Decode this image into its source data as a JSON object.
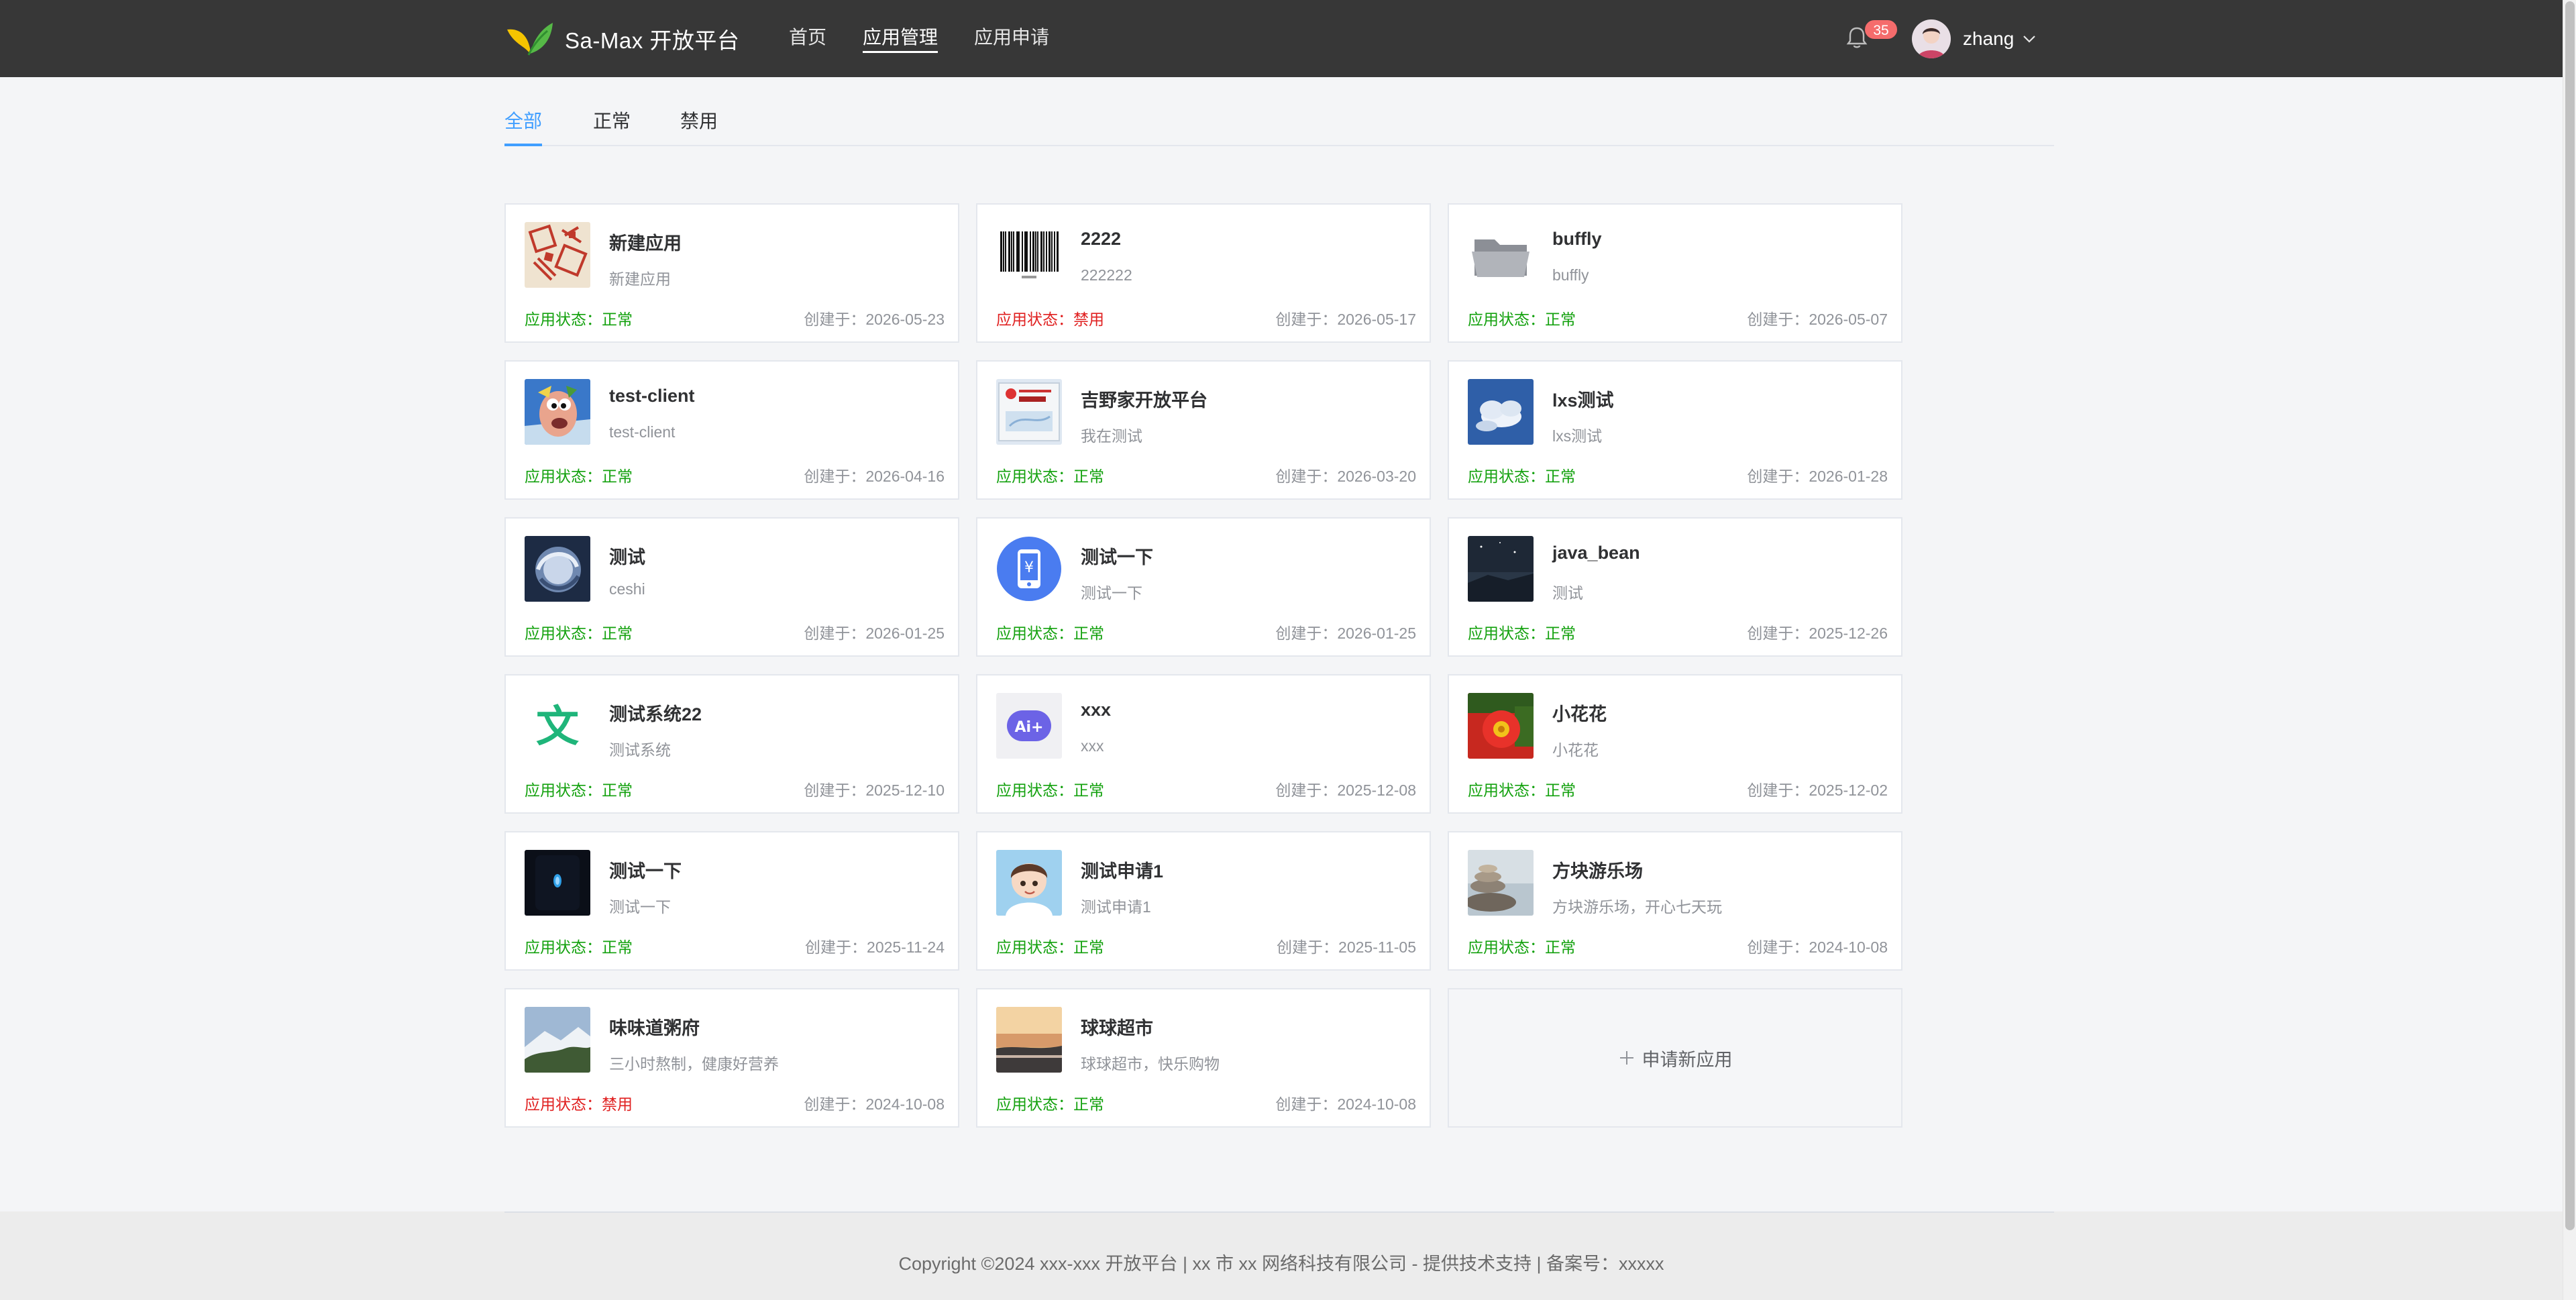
{
  "header": {
    "brand": "Sa-Max 开放平台",
    "nav": [
      "首页",
      "应用管理",
      "应用申请"
    ],
    "active_nav": 1,
    "notification_count": "35",
    "username": "zhang"
  },
  "tabs": [
    "全部",
    "正常",
    "禁用"
  ],
  "active_tab": 0,
  "status_label": "应用状态：",
  "created_label": "创建于：",
  "apps": [
    {
      "name": "新建应用",
      "desc": "新建应用",
      "status": "正常",
      "status_ok": true,
      "date": "2026-05-23",
      "icon": "stamp-seal-icon"
    },
    {
      "name": "2222",
      "desc": "222222",
      "status": "禁用",
      "status_ok": false,
      "date": "2026-05-17",
      "icon": "barcode-icon"
    },
    {
      "name": "buffly",
      "desc": "buffly",
      "status": "正常",
      "status_ok": true,
      "date": "2026-05-07",
      "icon": "folder-icon"
    },
    {
      "name": "test-client",
      "desc": "test-client",
      "status": "正常",
      "status_ok": true,
      "date": "2026-04-16",
      "icon": "cartoon-character-icon"
    },
    {
      "name": "吉野家开放平台",
      "desc": "我在测试",
      "status": "正常",
      "status_ok": true,
      "date": "2026-03-20",
      "icon": "id-card-icon"
    },
    {
      "name": "lxs测试",
      "desc": "lxs测试",
      "status": "正常",
      "status_ok": true,
      "date": "2026-01-28",
      "icon": "cloud-sky-icon"
    },
    {
      "name": "测试",
      "desc": "ceshi",
      "status": "正常",
      "status_ok": true,
      "date": "2026-01-25",
      "icon": "storm-photo-icon"
    },
    {
      "name": "测试一下",
      "desc": "测试一下",
      "status": "正常",
      "status_ok": true,
      "date": "2026-01-25",
      "icon": "mobile-payment-icon"
    },
    {
      "name": "java_bean",
      "desc": "测试",
      "status": "正常",
      "status_ok": true,
      "date": "2025-12-26",
      "icon": "night-sky-icon"
    },
    {
      "name": "测试系统22",
      "desc": "测试系统",
      "status": "正常",
      "status_ok": true,
      "date": "2025-12-10",
      "icon": "text-character-icon"
    },
    {
      "name": "xxx",
      "desc": "xxx",
      "status": "正常",
      "status_ok": true,
      "date": "2025-12-08",
      "icon": "ai-plus-icon"
    },
    {
      "name": "小花花",
      "desc": "小花花",
      "status": "正常",
      "status_ok": true,
      "date": "2025-12-02",
      "icon": "red-flower-icon"
    },
    {
      "name": "测试一下",
      "desc": "测试一下",
      "status": "正常",
      "status_ok": true,
      "date": "2025-11-24",
      "icon": "dark-phone-icon"
    },
    {
      "name": "测试申请1",
      "desc": "测试申请1",
      "status": "正常",
      "status_ok": true,
      "date": "2025-11-05",
      "icon": "boy-avatar-icon"
    },
    {
      "name": "方块游乐场",
      "desc": "方块游乐场，开心七天玩",
      "status": "正常",
      "status_ok": true,
      "date": "2024-10-08",
      "icon": "stones-photo-icon"
    },
    {
      "name": "味味道粥府",
      "desc": "三小时熬制，健康好营养",
      "status": "禁用",
      "status_ok": false,
      "date": "2024-10-08",
      "icon": "mountain-photo-icon"
    },
    {
      "name": "球球超市",
      "desc": "球球超市，快乐购物",
      "status": "正常",
      "status_ok": true,
      "date": "2024-10-08",
      "icon": "sunset-photo-icon"
    }
  ],
  "add_app_label": "申请新应用",
  "footer": "Copyright ©2024 xxx-xxx 开放平台 | xx 市 xx 网络科技有限公司 - 提供技术支持 | 备案号：xxxxx"
}
